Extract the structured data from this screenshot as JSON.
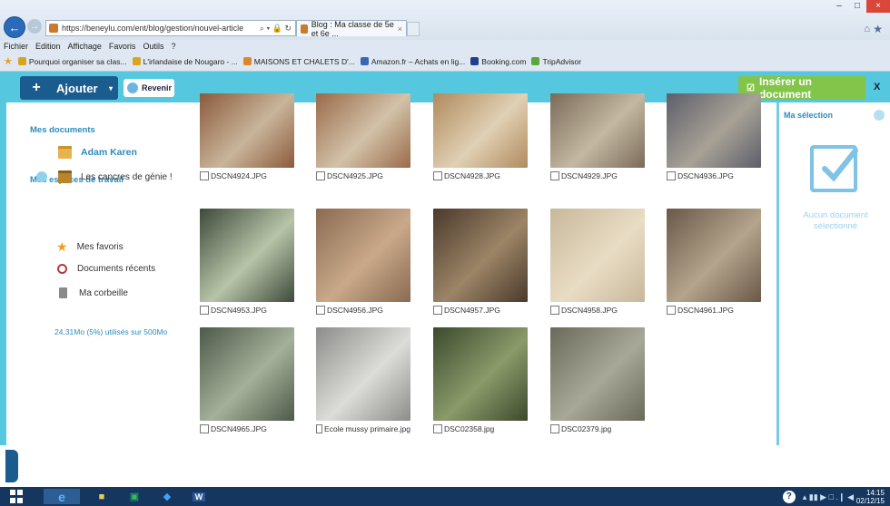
{
  "browser": {
    "url": "https://beneylu.com/ent/blog/gestion/nouvel-article",
    "address_controls": "⌕ ▾ 🔒 ↻",
    "tab_title": "Blog : Ma classe de 5e et 6e ...",
    "tab_close": "×",
    "window_controls": {
      "minimize": "–",
      "maximize": "□",
      "close": "×"
    },
    "menu": [
      "Fichier",
      "Edition",
      "Affichage",
      "Favoris",
      "Outils",
      "?"
    ],
    "favorites": [
      {
        "label": "Pourquoi organiser sa clas...",
        "icon_color": "#d9a521"
      },
      {
        "label": "L'irlandaise de Nougaro - ...",
        "icon_color": "#d9a521"
      },
      {
        "label": "MAISONS ET CHALETS D'...",
        "icon_color": "#e0862a"
      },
      {
        "label": "Amazon.fr – Achats en lig...",
        "icon_color": "#3a66b0"
      },
      {
        "label": "Booking.com",
        "icon_color": "#1f3f8a"
      },
      {
        "label": "TripAdvisor",
        "icon_color": "#5aa83a"
      }
    ]
  },
  "toolbar": {
    "add_label": "Ajouter",
    "add_icon": "+",
    "add_caret": "▾",
    "back_label": "Revenir",
    "insert_label": "Insérer un document",
    "insert_icon": "☑",
    "close_label": "X"
  },
  "sidebar": {
    "my_documents_title": "Mes documents",
    "my_documents_user": "Adam Karen",
    "workspaces_title": "Mes espaces de travail",
    "workspace_item": "Les cancres de génie !",
    "favorites": "Mes favoris",
    "recent": "Documents récents",
    "trash": "Ma corbeille",
    "star_glyph": "★",
    "quota": "24.31Mo (5%) utilisés sur 500Mo"
  },
  "grid": {
    "images": [
      {
        "name": "DSCN4924.JPG",
        "c1": "#8b5a3c",
        "c2": "#c9b59a"
      },
      {
        "name": "DSCN4925.JPG",
        "c1": "#9a6a4a",
        "c2": "#d2c2a8"
      },
      {
        "name": "DSCN4928.JPG",
        "c1": "#b08a5e",
        "c2": "#e0d0b4"
      },
      {
        "name": "DSCN4929.JPG",
        "c1": "#7a6b58",
        "c2": "#c4b8a2"
      },
      {
        "name": "DSCN4936.JPG",
        "c1": "#5c5e6a",
        "c2": "#a8a296"
      },
      {
        "name": "DSCN4953.JPG",
        "c1": "#3d4a3a",
        "c2": "#b8c4a8"
      },
      {
        "name": "DSCN4956.JPG",
        "c1": "#8a6a52",
        "c2": "#c9a989"
      },
      {
        "name": "DSCN4957.JPG",
        "c1": "#4a3a2c",
        "c2": "#9c8466"
      },
      {
        "name": "DSCN4958.JPG",
        "c1": "#c8b89a",
        "c2": "#e8dcc4"
      },
      {
        "name": "DSCN4961.JPG",
        "c1": "#6a5848",
        "c2": "#b4a48c"
      },
      {
        "name": "DSCN4965.JPG",
        "c1": "#4e5a4a",
        "c2": "#a4b098"
      },
      {
        "name": "Ecole mussy primaire.jpg",
        "c1": "#8c8c8a",
        "c2": "#dcdcd8"
      },
      {
        "name": "DSC02358.jpg",
        "c1": "#3c4a2c",
        "c2": "#8a9a6a"
      },
      {
        "name": "DSC02379.jpg",
        "c1": "#6a6a5a",
        "c2": "#a8a898"
      }
    ]
  },
  "selection": {
    "title": "Ma sélection",
    "empty_text": "Aucun document sélectionné"
  },
  "taskbar": {
    "ie_label": "e",
    "files_label": "■",
    "store_label": "▣",
    "shield_label": "◆",
    "word_label": "W",
    "help_label": "?",
    "tray": "▴  ▮▮  ▶  □  .❙  ◀",
    "time": "14:15",
    "date": "02/12/15"
  },
  "colors": {
    "accent": "#55c8e0",
    "primary": "#1b5c8e",
    "insert": "#83c44a",
    "link": "#2b8bbf"
  }
}
